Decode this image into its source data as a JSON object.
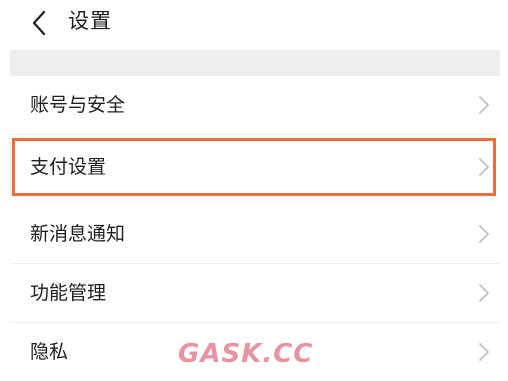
{
  "header": {
    "back_icon": "chevron-left-icon",
    "title": "设置"
  },
  "menu": {
    "items": [
      {
        "label": "账号与安全",
        "icon": "chevron-right-icon"
      },
      {
        "label": "支付设置",
        "icon": "chevron-right-icon",
        "highlighted": true
      },
      {
        "label": "新消息通知",
        "icon": "chevron-right-icon"
      },
      {
        "label": "功能管理",
        "icon": "chevron-right-icon"
      },
      {
        "label": "隐私",
        "icon": "chevron-right-icon"
      }
    ]
  },
  "watermark": {
    "text": "GASK.CC"
  },
  "colors": {
    "highlight_border": "#e76f3c",
    "section_gap": "#eeeeee",
    "watermark": "#d63b52"
  }
}
